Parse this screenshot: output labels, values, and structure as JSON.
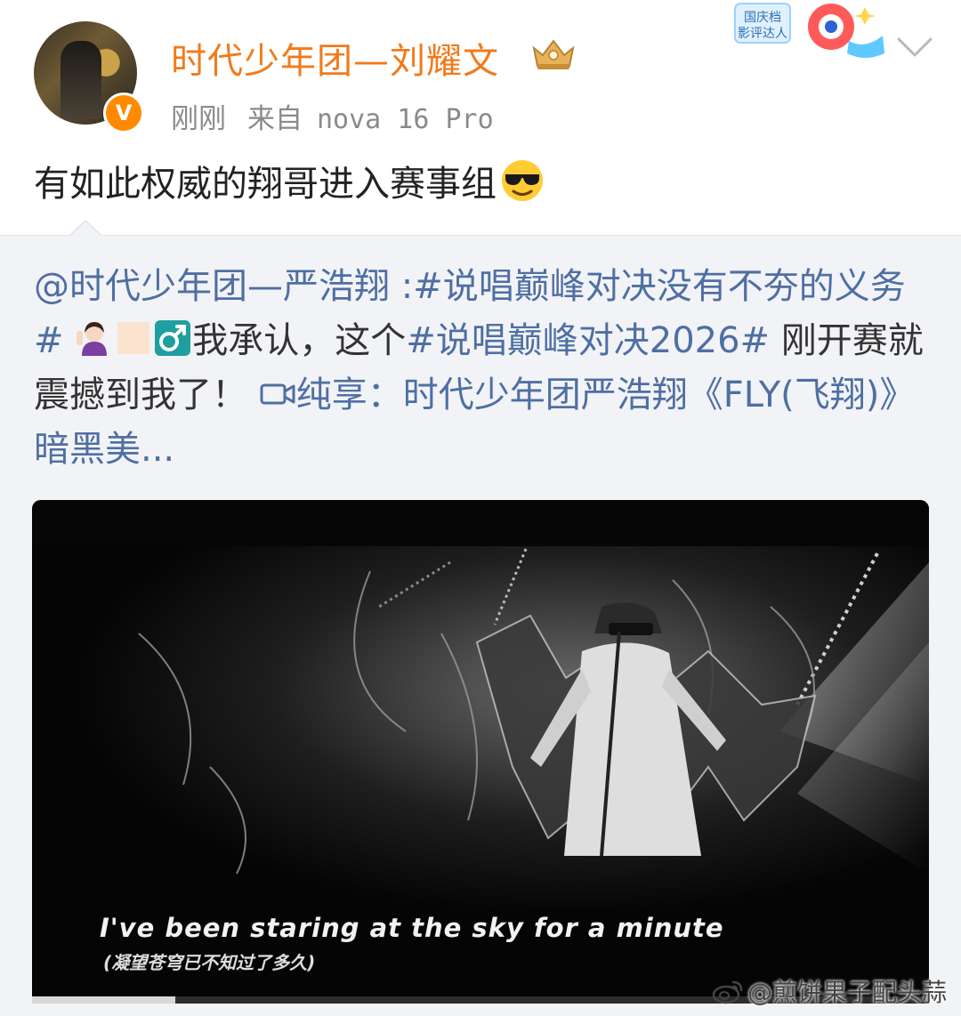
{
  "post": {
    "author": "时代少年团—刘耀文",
    "time": "刚刚",
    "source_prefix": "来自",
    "device": "nova 16 Pro",
    "text": "有如此权威的翔哥进入赛事组",
    "badge_line1": "国庆档",
    "badge_line2": "影评达人"
  },
  "repost": {
    "mention": "@时代少年团—严浩翔",
    "colon": " :",
    "hashtag1": "#说唱巅峰对决没有不夯的义务#",
    "text1": "我承认，这个",
    "hashtag2": "#说唱巅峰对决2026#",
    "text2": "刚开赛就震撼到我了！",
    "video_link": "纯享：时代少年团严浩翔《FLY(飞翔)》暗黑美..."
  },
  "video": {
    "subtitle_en": "I've been staring at the sky for a minute",
    "subtitle_zh": "(凝望苍穹已不知过了多久)",
    "progress": 0.16
  },
  "watermark": "@煎饼果子配头蒜",
  "colors": {
    "author": "#f07b1c",
    "link": "#4f6fa3",
    "repost_bg": "#f2f3f6",
    "verified": "#ff8a00"
  },
  "icons": [
    "verified-icon",
    "crown-icon",
    "chevron-down-icon",
    "sunglasses-emoji",
    "woman-tipping-hand-emoji",
    "male-sign-emoji",
    "video-icon",
    "weibo-logo-icon"
  ]
}
